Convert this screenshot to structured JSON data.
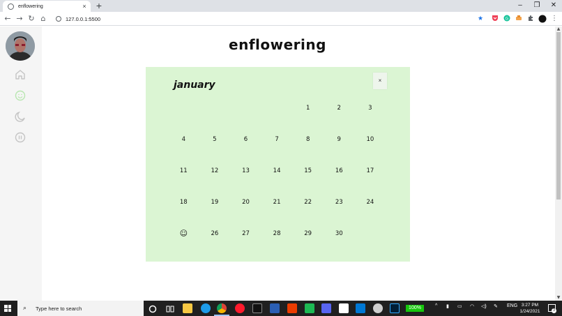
{
  "browser": {
    "tab_title": "enflowering",
    "tab_close": "×",
    "new_tab": "+",
    "url": "127.0.0.1:5500",
    "window_controls": {
      "minimize": "–",
      "restore": "❐",
      "close": "✕"
    },
    "nav": {
      "back": "←",
      "forward": "→",
      "reload": "↻",
      "home": "⌂"
    },
    "star": "★",
    "menu": "⋮"
  },
  "page": {
    "title": "enflowering",
    "calendar": {
      "month": "january",
      "close_label": "×",
      "days": [
        "",
        "",
        "",
        "",
        "1",
        "2",
        "3",
        "4",
        "5",
        "6",
        "7",
        "8",
        "9",
        "10",
        "11",
        "12",
        "13",
        "14",
        "15",
        "16",
        "17",
        "18",
        "19",
        "20",
        "21",
        "22",
        "23",
        "24",
        "☺",
        "26",
        "27",
        "28",
        "29",
        "30",
        ""
      ],
      "today_index": 28,
      "background_color": "#dbf5d3"
    },
    "sidebar": {
      "icons": [
        "home-icon",
        "smile-icon",
        "moon-icon",
        "pause-icon"
      ],
      "active_color": "#b8e6b0",
      "icon_color": "#c4c4c4"
    }
  },
  "taskbar": {
    "search_placeholder": "Type here to search",
    "battery": "100%",
    "language": "ENG",
    "time": "3:27 PM",
    "date": "1/24/2021",
    "notifications": "3"
  }
}
